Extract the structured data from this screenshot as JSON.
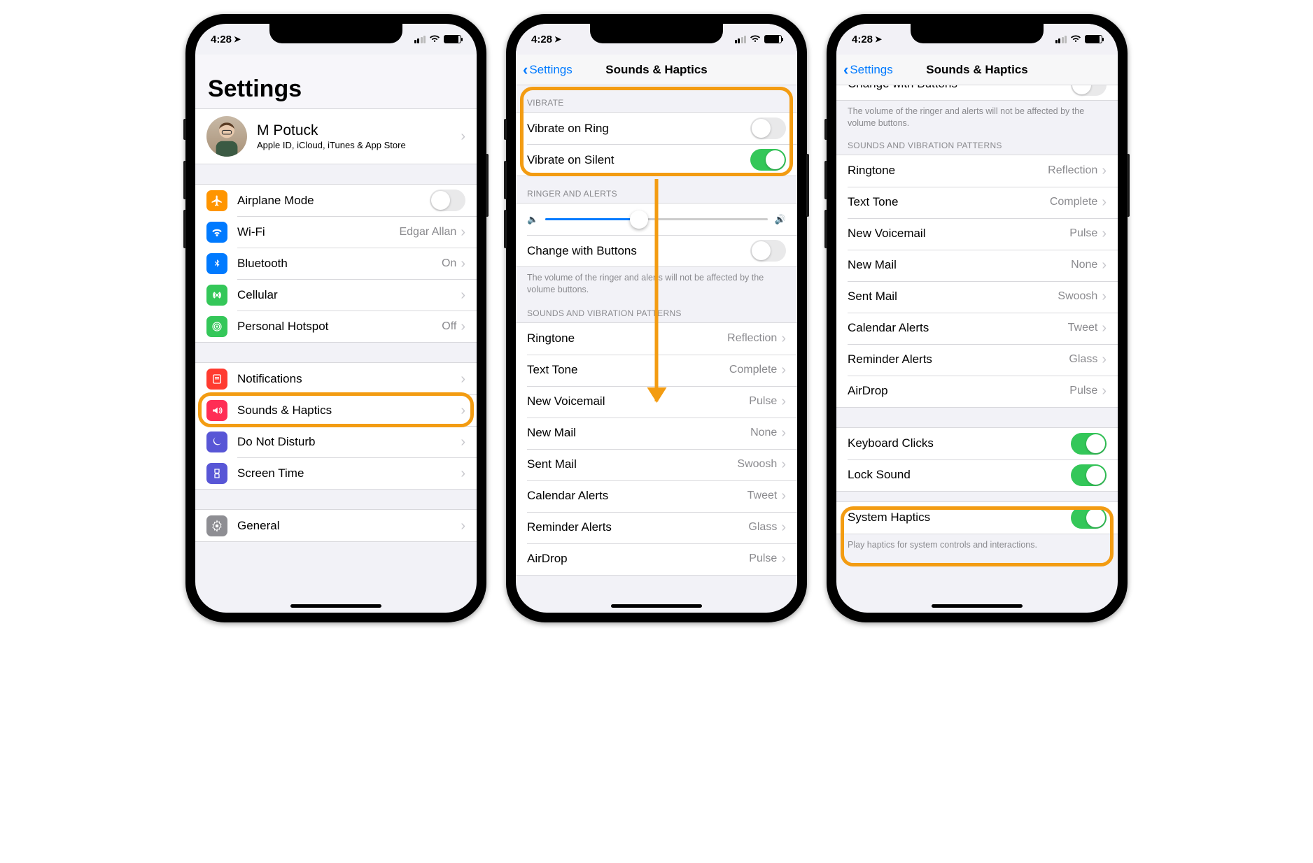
{
  "status": {
    "time": "4:28"
  },
  "p1": {
    "title": "Settings",
    "profile": {
      "name": "M Potuck",
      "sub": "Apple ID, iCloud, iTunes & App Store"
    },
    "g1": [
      {
        "icon": "airplane",
        "color": "#ff9500",
        "label": "Airplane Mode",
        "toggle": false
      },
      {
        "icon": "wifi",
        "color": "#007aff",
        "label": "Wi-Fi",
        "detail": "Edgar Allan"
      },
      {
        "icon": "bluetooth",
        "color": "#007aff",
        "label": "Bluetooth",
        "detail": "On"
      },
      {
        "icon": "cellular",
        "color": "#34c759",
        "label": "Cellular"
      },
      {
        "icon": "hotspot",
        "color": "#34c759",
        "label": "Personal Hotspot",
        "detail": "Off"
      }
    ],
    "g2": [
      {
        "icon": "notifications",
        "color": "#ff3b30",
        "label": "Notifications"
      },
      {
        "icon": "sounds",
        "color": "#ff2d55",
        "label": "Sounds & Haptics",
        "highlight": true
      },
      {
        "icon": "dnd",
        "color": "#5856d6",
        "label": "Do Not Disturb"
      },
      {
        "icon": "screentime",
        "color": "#5856d6",
        "label": "Screen Time"
      }
    ],
    "g3": [
      {
        "icon": "general",
        "color": "#8e8e93",
        "label": "General"
      }
    ]
  },
  "p2": {
    "back": "Settings",
    "title": "Sounds & Haptics",
    "vibrate_header": "VIBRATE",
    "vibrate": [
      {
        "label": "Vibrate on Ring",
        "on": false
      },
      {
        "label": "Vibrate on Silent",
        "on": true
      }
    ],
    "ringer_header": "RINGER AND ALERTS",
    "change_buttons": {
      "label": "Change with Buttons",
      "on": false
    },
    "ringer_footer": "The volume of the ringer and alerts will not be affected by the volume buttons.",
    "patterns_header": "SOUNDS AND VIBRATION PATTERNS",
    "patterns": [
      {
        "label": "Ringtone",
        "detail": "Reflection"
      },
      {
        "label": "Text Tone",
        "detail": "Complete"
      },
      {
        "label": "New Voicemail",
        "detail": "Pulse"
      },
      {
        "label": "New Mail",
        "detail": "None"
      },
      {
        "label": "Sent Mail",
        "detail": "Swoosh"
      },
      {
        "label": "Calendar Alerts",
        "detail": "Tweet"
      },
      {
        "label": "Reminder Alerts",
        "detail": "Glass"
      },
      {
        "label": "AirDrop",
        "detail": "Pulse"
      }
    ]
  },
  "p3": {
    "back": "Settings",
    "title": "Sounds & Haptics",
    "cut_label": "Change with Buttons",
    "ringer_footer": "The volume of the ringer and alerts will not be affected by the volume buttons.",
    "patterns_header": "SOUNDS AND VIBRATION PATTERNS",
    "patterns": [
      {
        "label": "Ringtone",
        "detail": "Reflection"
      },
      {
        "label": "Text Tone",
        "detail": "Complete"
      },
      {
        "label": "New Voicemail",
        "detail": "Pulse"
      },
      {
        "label": "New Mail",
        "detail": "None"
      },
      {
        "label": "Sent Mail",
        "detail": "Swoosh"
      },
      {
        "label": "Calendar Alerts",
        "detail": "Tweet"
      },
      {
        "label": "Reminder Alerts",
        "detail": "Glass"
      },
      {
        "label": "AirDrop",
        "detail": "Pulse"
      }
    ],
    "g2": [
      {
        "label": "Keyboard Clicks",
        "on": true
      },
      {
        "label": "Lock Sound",
        "on": true
      }
    ],
    "system_haptics": {
      "label": "System Haptics",
      "on": true
    },
    "haptics_footer": "Play haptics for system controls and interactions."
  }
}
